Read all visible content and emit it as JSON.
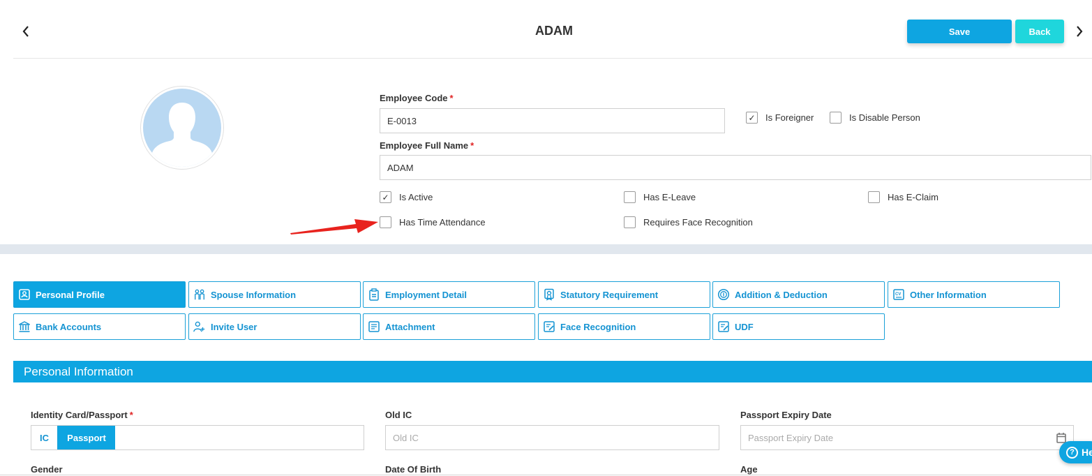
{
  "header": {
    "title": "ADAM",
    "save_label": "Save",
    "back_label": "Back",
    "prev_icon": "chevron-left-icon",
    "next_icon": "chevron-right-icon"
  },
  "profile": {
    "employee_code_label": "Employee Code",
    "employee_code_value": "E-0013",
    "full_name_label": "Employee Full Name",
    "full_name_value": "ADAM",
    "required_mark": "*",
    "is_foreigner": {
      "label": "Is Foreigner",
      "checked": true
    },
    "is_disable_person": {
      "label": "Is Disable Person",
      "checked": false
    },
    "is_active": {
      "label": "Is Active",
      "checked": true
    },
    "has_e_leave": {
      "label": "Has E-Leave",
      "checked": false
    },
    "has_e_claim": {
      "label": "Has E-Claim",
      "checked": false
    },
    "has_time_attendance": {
      "label": "Has Time Attendance",
      "checked": false
    },
    "requires_face_recognition": {
      "label": "Requires Face Recognition",
      "checked": false
    }
  },
  "tabs": [
    {
      "label": "Personal Profile",
      "icon": "profile-icon",
      "active": true
    },
    {
      "label": "Spouse Information",
      "icon": "couple-icon",
      "active": false
    },
    {
      "label": "Employment Detail",
      "icon": "clipboard-icon",
      "active": false
    },
    {
      "label": "Statutory Requirement",
      "icon": "certificate-icon",
      "active": false
    },
    {
      "label": "Addition & Deduction",
      "icon": "coin-icon",
      "active": false
    },
    {
      "label": "Other Information",
      "icon": "cv-icon",
      "active": false
    },
    {
      "label": "Bank Accounts",
      "icon": "bank-icon",
      "active": false
    },
    {
      "label": "Invite User",
      "icon": "add-user-icon",
      "active": false
    },
    {
      "label": "Attachment",
      "icon": "document-icon",
      "active": false
    },
    {
      "label": "Face Recognition",
      "icon": "document-edit-icon",
      "active": false
    },
    {
      "label": "UDF",
      "icon": "document-edit-icon",
      "active": false
    }
  ],
  "personal_info": {
    "section_title": "Personal Information",
    "identity_label": "Identity Card/Passport",
    "identity_options": [
      "IC",
      "Passport"
    ],
    "identity_selected": "Passport",
    "old_ic_label": "Old IC",
    "old_ic_placeholder": "Old IC",
    "passport_expiry_label": "Passport Expiry Date",
    "passport_expiry_placeholder": "Passport Expiry Date",
    "gender_label": "Gender",
    "dob_label": "Date Of Birth",
    "age_label": "Age"
  },
  "help": {
    "label": "He"
  },
  "colors": {
    "primary": "#0ea5e1",
    "secondary": "#1fd6dc",
    "required": "#e02424",
    "annotation_arrow": "#e8231e"
  }
}
